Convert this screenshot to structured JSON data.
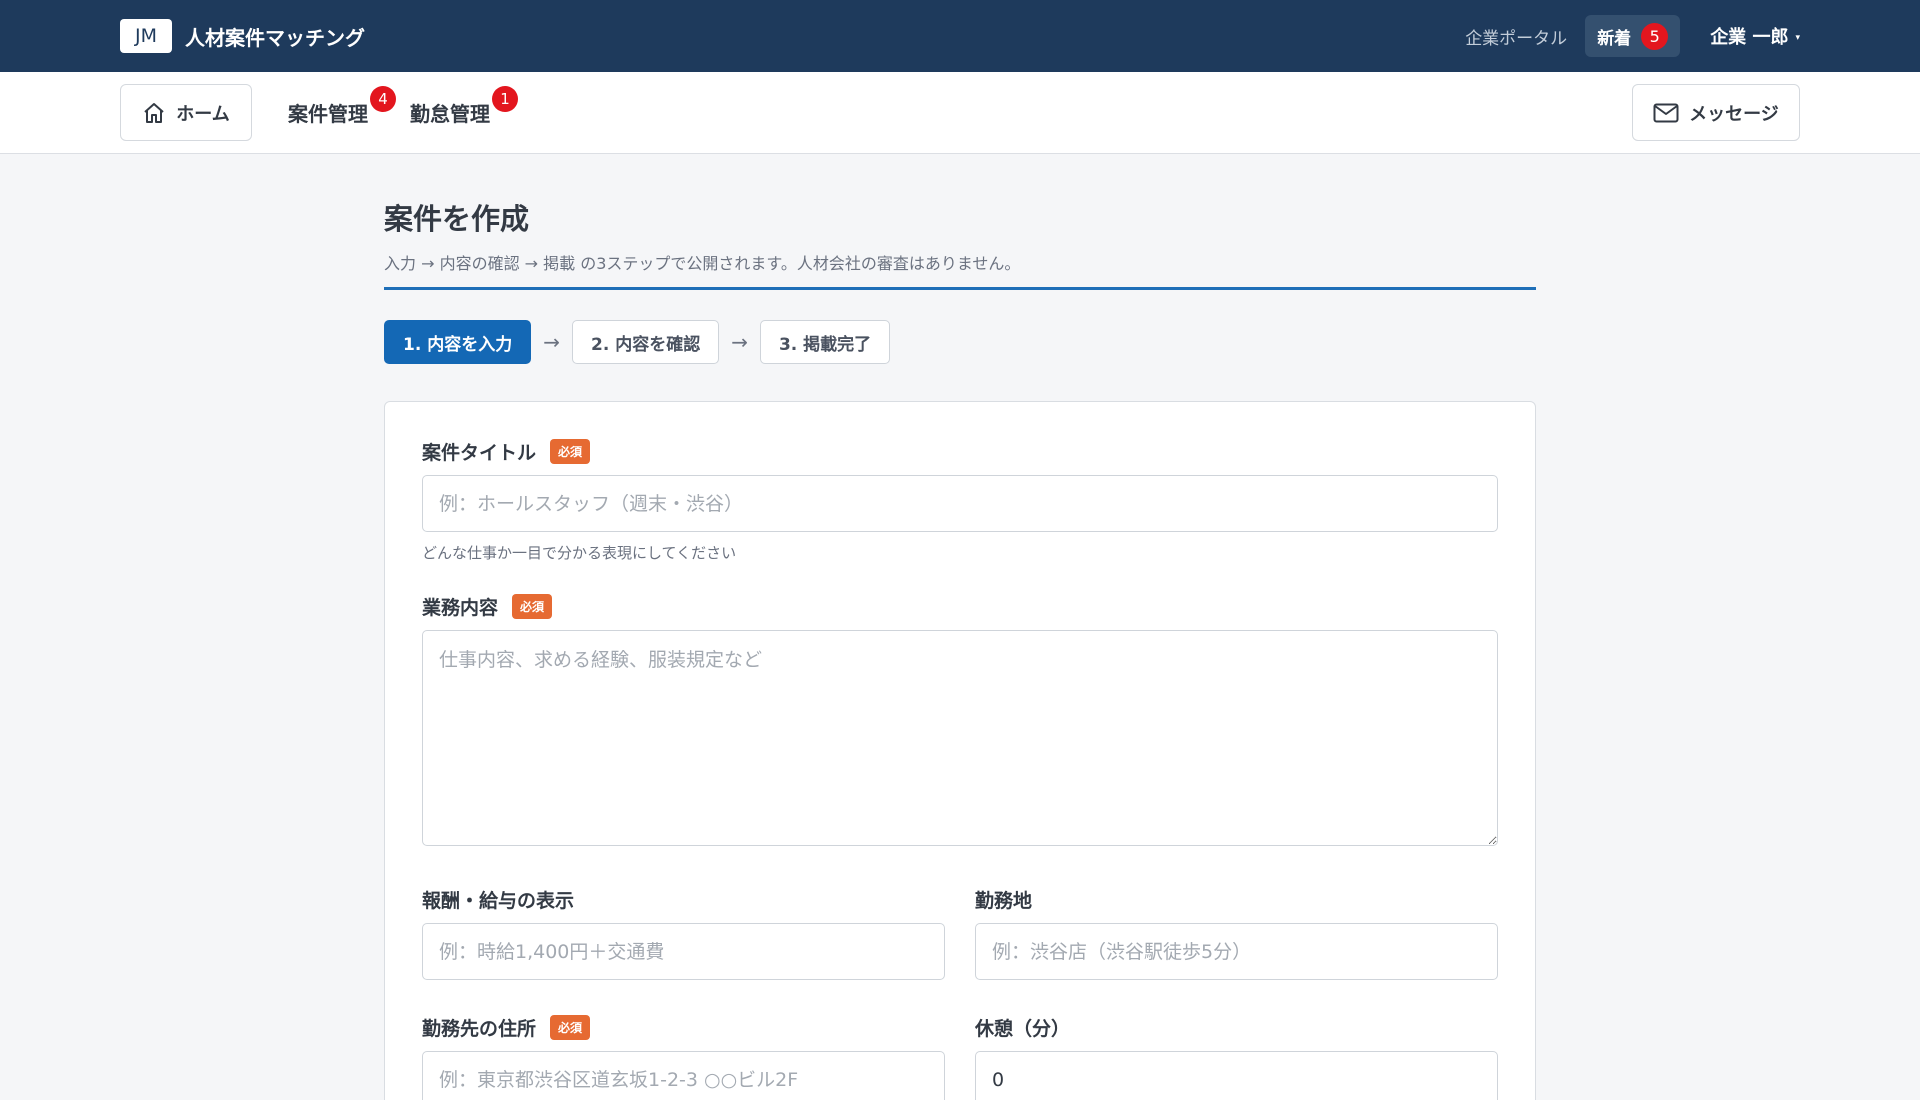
{
  "header": {
    "logo": "JM",
    "app_title": "人材案件マッチング",
    "portal_label": "企業ポータル",
    "news_label": "新着",
    "news_count": "5",
    "user_name": "企業 一郎",
    "user_caret": "▾"
  },
  "nav": {
    "home_label": "ホーム",
    "items": [
      {
        "label": "案件管理",
        "badge": "4"
      },
      {
        "label": "勤怠管理",
        "badge": "1"
      }
    ],
    "messages_label": "メッセージ"
  },
  "page": {
    "title": "案件を作成",
    "subtitle": "入力 → 内容の確認 → 掲載 の3ステップで公開されます。人材会社の審査はありません。"
  },
  "steps": [
    {
      "label": "1. 内容を入力",
      "active": true
    },
    {
      "label": "2. 内容を確認",
      "active": false
    },
    {
      "label": "3. 掲載完了",
      "active": false
    }
  ],
  "step_arrow": "→",
  "form": {
    "title": {
      "label": "案件タイトル",
      "required": "必須",
      "placeholder": "例：ホールスタッフ（週末・渋谷）",
      "hint": "どんな仕事か一目で分かる表現にしてください",
      "value": ""
    },
    "description": {
      "label": "業務内容",
      "required": "必須",
      "placeholder": "仕事内容、求める経験、服装規定など",
      "value": ""
    },
    "salary": {
      "label": "報酬・給与の表示",
      "placeholder": "例：時給1,400円＋交通費",
      "value": ""
    },
    "location": {
      "label": "勤務地",
      "placeholder": "例：渋谷店（渋谷駅徒歩5分）",
      "value": ""
    },
    "address": {
      "label": "勤務先の住所",
      "required": "必須",
      "placeholder": "例：東京都渋谷区道玄坂1-2-3 ○○ビル2F",
      "value": ""
    },
    "break": {
      "label": "休憩（分）",
      "placeholder": "",
      "value": "0"
    }
  },
  "colors": {
    "topbar": "#1e3a5c",
    "accent": "#1468b5",
    "required_badge": "#e66a32",
    "notification_badge": "#e3161e"
  }
}
